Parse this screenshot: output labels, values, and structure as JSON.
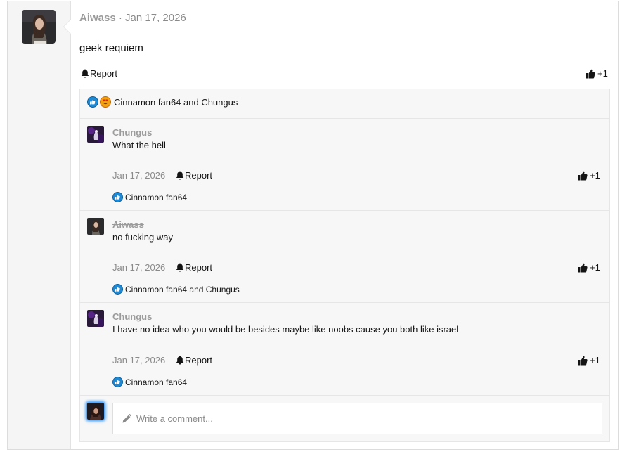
{
  "post": {
    "author": "Aiwass",
    "separator": " · ",
    "date": "Jan 17, 2026",
    "body": "geek requiem",
    "report_label": "Report",
    "like_label": "+1",
    "reaction_summary": "Cinnamon fan64 and Chungus"
  },
  "comments": [
    {
      "author": "Chungus",
      "text": "What the hell",
      "date": "Jan 17, 2026",
      "report_label": "Report",
      "like_label": "+1",
      "reactions": "Cinnamon fan64"
    },
    {
      "author": "Aiwass",
      "text": "no fucking way",
      "date": "Jan 17, 2026",
      "report_label": "Report",
      "like_label": "+1",
      "reactions": "Cinnamon fan64 and Chungus"
    },
    {
      "author": "Chungus",
      "text": "I have no idea who you would be besides maybe like noobs cause you both like israel",
      "date": "Jan 17, 2026",
      "report_label": "Report",
      "like_label": "+1",
      "reactions": "Cinnamon fan64"
    }
  ],
  "composer": {
    "placeholder": "Write a comment..."
  },
  "icons": {
    "report": "bell-icon",
    "like": "thumbs-up-icon",
    "reaction_like": "like-reaction-icon",
    "reaction_love": "heart-eyes-reaction-icon",
    "composer": "pencil-icon"
  },
  "colors": {
    "muted_text": "#8a8a8a",
    "reaction_blue": "#1e8ad6",
    "reaction_orange": "#f2a20f",
    "composer_glow": "#1f8fff"
  }
}
